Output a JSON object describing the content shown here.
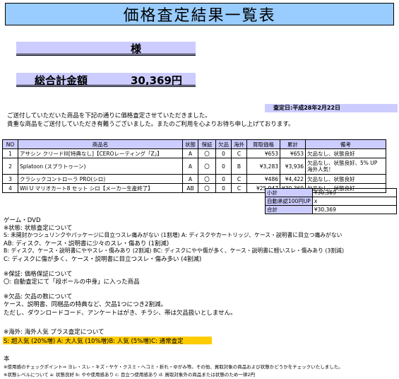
{
  "header": {
    "title": "価格査定結果一覧表"
  },
  "customer": {
    "honorific": "様"
  },
  "total": {
    "label": "総合計金額",
    "value": "30,369円"
  },
  "date": {
    "text": "査定日:平成28年2月22日"
  },
  "message": {
    "line1": "ご送付していただいた商品を下記の通りに価格査定させていただきました。",
    "line2": "貴重な商品をご送付していただき有難うございました。またのご利用を心よりお待ち申し上げております。"
  },
  "table": {
    "headers": [
      "NO",
      "商品名",
      "状態",
      "保証",
      "欠品",
      "海外",
      "買取価格",
      "累計",
      "備考"
    ],
    "rows": [
      [
        "1",
        "アサシン クリードIII[特典なし]【CEROレーティング「Z」】",
        "A",
        "〇",
        "0",
        "C",
        "¥653",
        "¥653",
        "欠品なし、状態良好"
      ],
      [
        "2",
        "Splatoon (スプラトゥーン)",
        "A",
        "〇",
        "0",
        "B",
        "¥3,283",
        "¥3,936",
        "欠品なし、状態良好、5% UP 海外人気！"
      ],
      [
        "3",
        "クラシックコントローラ PRO(シロ)",
        "A",
        "〇",
        "0",
        "C",
        "¥486",
        "¥4,422",
        "欠品なし、状態良好"
      ],
      [
        "4",
        "Wii U マリオカート8 セット シロ【メーカー生産終了】",
        "AB",
        "〇",
        "0",
        "C",
        "¥25,947",
        "¥30,369",
        "欠品なし、状態良好"
      ]
    ]
  },
  "summary": [
    {
      "label": "小計",
      "value": "¥30,369"
    },
    {
      "label": "自動承認100円UP",
      "value": "x"
    },
    {
      "label": "合計",
      "value": "¥30,369"
    }
  ],
  "notes": {
    "section_title": "ゲーム・DVD",
    "condition_title": "※状態:  状態査定について",
    "condition_s": "S: 未開封かつシュリンクやパッケージに目立つスレ痛みがない (1割増)     A: ディスクやカートリッジ、ケース・説明書に目立つ痛みがない",
    "condition_ab": "AB:  ディスク、ケース・説明書に少々のスレ・傷あり (1割減)",
    "condition_b": "B: ディスク、ケース・説明書にややスレ・傷みあり (2割減)      BC: ディスクにやや傷が多く、ケース・説明書に軽いスレ・傷みあり (3割減)",
    "condition_c": "C: ディスクに傷が多く、ケース・説明書に目立つスレ・傷み多い (4割減)",
    "guarantee_title": "※保証:   価格保証について",
    "guarantee_text": "〇: 自動査定にて「段ボールの中身」に入った商品",
    "missing_title": "※欠品:   欠品の数について",
    "missing_text1": "ケース、説明書、同梱品の特典など、欠品1つにつき2割減。",
    "missing_text2": "ただし、ダウンロードコード、アンケートはがき、チラシ、帯は欠品扱いとしません。",
    "overseas_title": "※海外:   海外人気  プラス査定について",
    "overseas_text": "S: 超人気 (20%増)  A: 大人気 (10%増)B: 人気 (5%増)C: 通常査定",
    "book_title": "本",
    "book_text1": "※使用感のチェックポイント⇒ ヨレ・スレ・キズ・ヤケ・クスミ・ヘコミ・折れ・ゆがみ等。その他、買取対象の商品および状態かどうかをチェックいたしました。",
    "book_text2": "※状態レベルについて  a: 状態良好   b: やや使用感あり   c: 目立つ使用感あり   d: 買取対象外の商品または状態のため一律2円"
  }
}
